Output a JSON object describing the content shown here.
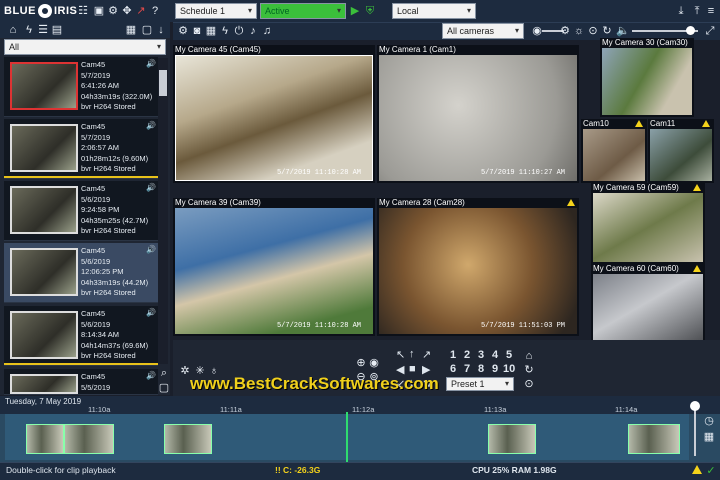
{
  "app": {
    "logo_left": "BLUE",
    "logo_right": "IRIS"
  },
  "toolbar": {
    "schedule_value": "Schedule 1",
    "status_value": "Active",
    "profile_value": "Local",
    "cameras_value": "All cameras"
  },
  "leftpanel": {
    "filter_value": "All",
    "clips": [
      {
        "camera": "Cam45",
        "date": "5/7/2019",
        "time": "6:41:26 AM",
        "length": "04h33m19s (322.0M)",
        "format": "bvr H264 Stored"
      },
      {
        "camera": "Cam45",
        "date": "5/7/2019",
        "time": "2:06:57 AM",
        "length": "01h28m12s (9.60M)",
        "format": "bvr H264 Stored"
      },
      {
        "camera": "Cam45",
        "date": "5/6/2019",
        "time": "9:24:58 PM",
        "length": "04h35m25s (42.7M)",
        "format": "bvr H264 Stored"
      },
      {
        "camera": "Cam45",
        "date": "5/6/2019",
        "time": "12:06:25 PM",
        "length": "04h33m19s (44.2M)",
        "format": "bvr H264 Stored"
      },
      {
        "camera": "Cam45",
        "date": "5/6/2019",
        "time": "8:14:34 AM",
        "length": "04h14m37s (69.6M)",
        "format": "bvr H264 Stored"
      },
      {
        "camera": "Cam45",
        "date": "5/5/2019",
        "time": "",
        "length": "",
        "format": ""
      }
    ]
  },
  "cameras": [
    {
      "title": "My Camera 45 (Cam45)",
      "timestamp": "5/7/2019  11:10:28 AM"
    },
    {
      "title": "My Camera 1 (Cam1)",
      "timestamp": "5/7/2019  11:10:27 AM"
    },
    {
      "title": "My Camera 30 (Cam30)",
      "timestamp": ""
    },
    {
      "title": "Cam10",
      "timestamp": ""
    },
    {
      "title": "Cam11",
      "timestamp": ""
    },
    {
      "title": "My Camera 39 (Cam39)",
      "timestamp": "5/7/2019  11:10:28 AM"
    },
    {
      "title": "My Camera 28 (Cam28)",
      "timestamp": "5/7/2019  11:51:03 PM"
    },
    {
      "title": "My Camera 59 (Cam59)",
      "timestamp": ""
    },
    {
      "title": "My Camera 60 (Cam60)",
      "timestamp": ""
    }
  ],
  "ptz": {
    "numbers": [
      "1",
      "2",
      "3",
      "4",
      "5",
      "6",
      "7",
      "8",
      "9",
      "10"
    ],
    "preset_value": "Preset 1"
  },
  "watermark": "www.BestCrackSoftwares.com",
  "timeline": {
    "date": "Tuesday, 7 May 2019",
    "ticks": [
      "11:10a",
      "11:11a",
      "11:12a",
      "11:13a",
      "11:14a"
    ]
  },
  "footer": {
    "hint": "Double-click for clip playback",
    "disk": "!! C: -26.3G",
    "stats": "CPU 25% RAM 1.98G"
  },
  "colors": {
    "accent": "#1d2b3f",
    "active_status": "#3bbf3b",
    "warning": "#f5d31b",
    "playhead": "#2fdc6f"
  }
}
